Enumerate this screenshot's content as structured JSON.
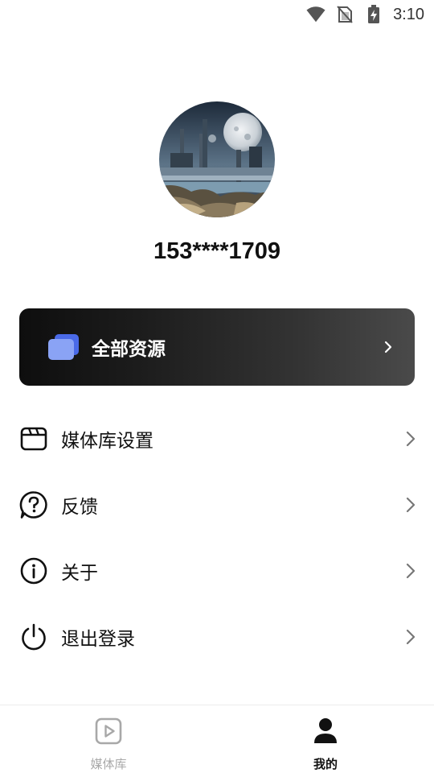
{
  "status_bar": {
    "time": "3:10",
    "icons": [
      "wifi-icon",
      "no-sim-icon",
      "battery-charging-icon"
    ]
  },
  "profile": {
    "avatar": "moon-city-landscape-image",
    "phone": "153****1709"
  },
  "resource_card": {
    "label": "全部资源",
    "icon": "folder-icon",
    "accent": "#5b7cf0"
  },
  "menu": {
    "items": [
      {
        "label": "媒体库设置",
        "icon": "media-library-icon"
      },
      {
        "label": "反馈",
        "icon": "question-bubble-icon"
      },
      {
        "label": "关于",
        "icon": "info-icon"
      },
      {
        "label": "退出登录",
        "icon": "power-icon"
      }
    ]
  },
  "tab_bar": {
    "tabs": [
      {
        "label": "媒体库",
        "icon": "play-square-icon",
        "active": false
      },
      {
        "label": "我的",
        "icon": "person-icon",
        "active": true
      }
    ]
  }
}
